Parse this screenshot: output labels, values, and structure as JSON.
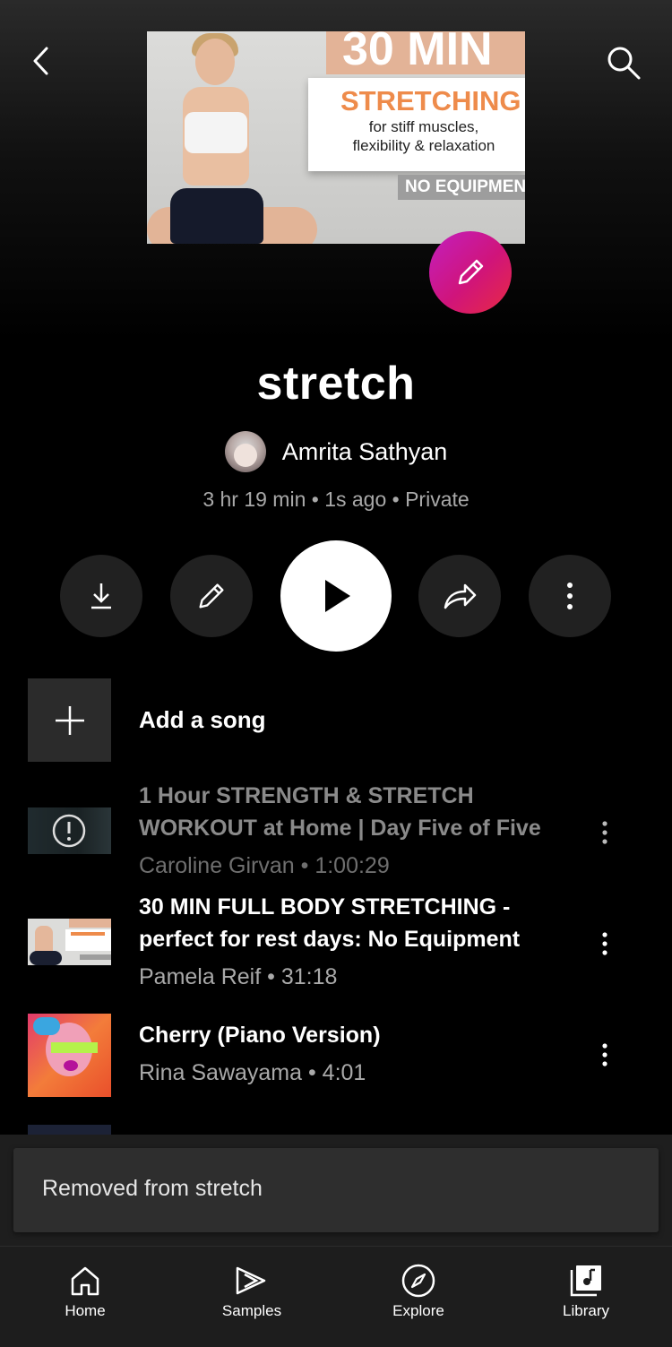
{
  "header": {
    "back_icon": "chevron-left-icon",
    "search_icon": "search-icon"
  },
  "cover": {
    "banner_top": "30 MIN",
    "card_heading": "STRETCHING",
    "card_line1": "for stiff muscles,",
    "card_line2": "flexibility & relaxation",
    "tag": "NO EQUIPMENT"
  },
  "playlist": {
    "title": "stretch",
    "owner": "Amrita Sathyan",
    "meta": "3 hr 19 min • 1s ago • Private"
  },
  "actions": {
    "download_icon": "download-icon",
    "edit_icon": "pencil-icon",
    "play_icon": "play-icon",
    "share_icon": "share-icon",
    "more_icon": "more-vertical-icon"
  },
  "add_song": {
    "label": "Add a song"
  },
  "tracks": [
    {
      "title": "1 Hour STRENGTH & STRETCH WORKOUT at Home | Day Five of Five",
      "subtitle": "Caroline Girvan • 1:00:29",
      "state": "unavailable"
    },
    {
      "title": "30 MIN FULL BODY STRETCHING - perfect for rest days: No Equipment",
      "subtitle": "Pamela Reif • 31:18",
      "state": "normal"
    },
    {
      "title": "Cherry (Piano Version)",
      "subtitle": "Rina Sawayama • 4:01",
      "state": "normal"
    }
  ],
  "toast": {
    "message": "Removed from stretch"
  },
  "nav": {
    "home": "Home",
    "samples": "Samples",
    "explore": "Explore",
    "library": "Library"
  },
  "colors": {
    "edit_gradient_start": "#c21fbf",
    "edit_gradient_end": "#e82a43",
    "background": "#000000"
  }
}
